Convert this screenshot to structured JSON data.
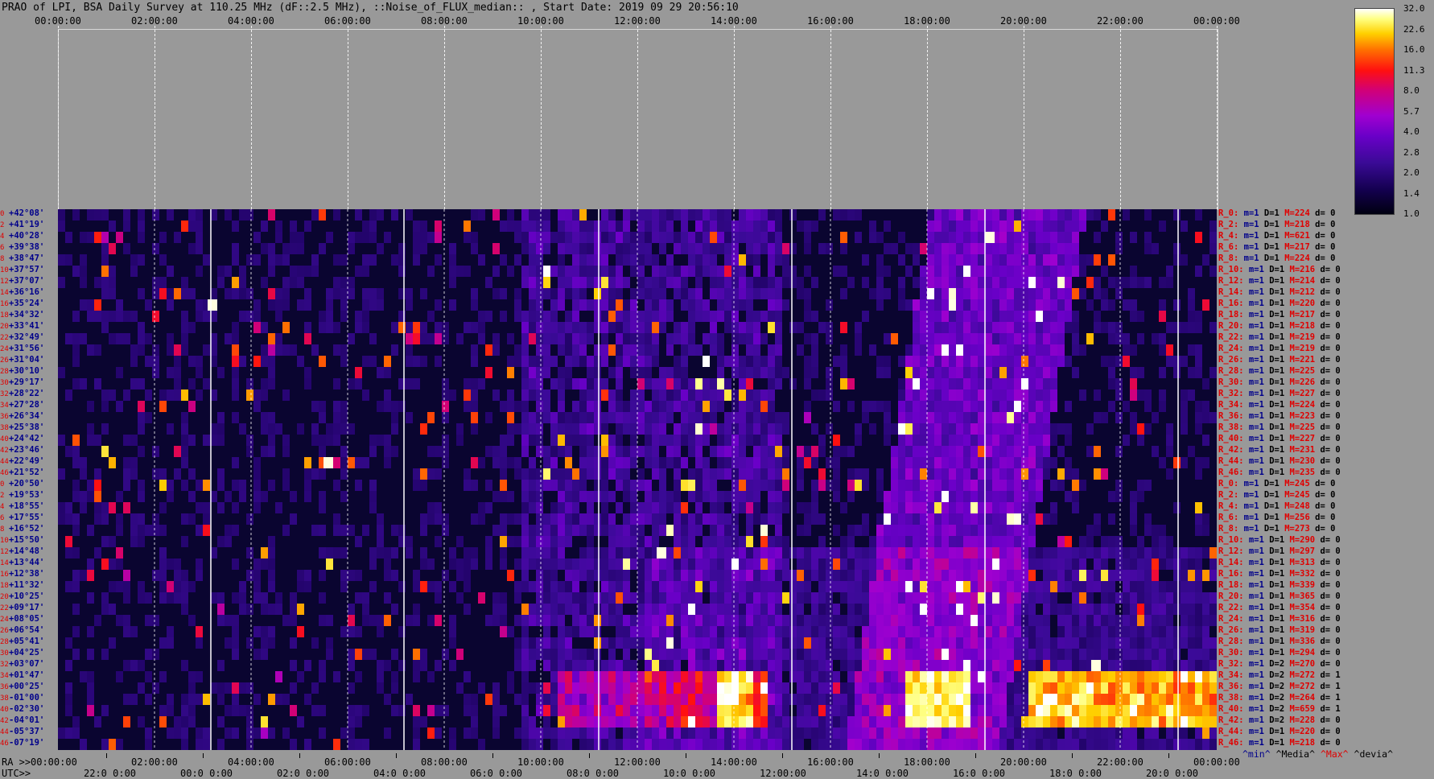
{
  "title": "PRAO of LPI, BSA Daily Survey at 110.25 MHz (dF::2.5 MHz), ::Noise_of_FLUX_median:: , Start Date: 2019 09 29 20:56:10",
  "top_axis": [
    "00:00:00",
    "02:00:00",
    "04:00:00",
    "06:00:00",
    "08:00:00",
    "10:00:00",
    "12:00:00",
    "14:00:00",
    "16:00:00",
    "18:00:00",
    "20:00:00",
    "22:00:00",
    "00:00:00"
  ],
  "bottom_axis": {
    "ra_label": "RA >>",
    "utc_label": "UTC>>",
    "ra_ticks": [
      "00:00:00",
      "02:00:00",
      "04:00:00",
      "06:00:00",
      "08:00:00",
      "10:00:00",
      "12:00:00",
      "14:00:00",
      "16:00:00",
      "18:00:00",
      "20:00:00",
      "22:00:00",
      "00:00:00"
    ],
    "utc_ticks": [
      "22:0 0:00",
      "00:0 0:00",
      "02:0 0:00",
      "04:0 0:00",
      "06:0 0:00",
      "08:0 0:00",
      "10:0 0:00",
      "12:00:00",
      "14:0 0:00",
      "16:0 0:00",
      "18:0 0:00",
      "20:0 0:00"
    ]
  },
  "colorbar": {
    "labels": [
      "32.0",
      "22.6",
      "16.0",
      "11.3",
      "8.0",
      "5.7",
      "4.0",
      "2.8",
      "2.0",
      "1.4",
      "1.0"
    ]
  },
  "legend_keys": {
    "min": "^min^",
    "median": "^Media^",
    "max": "^Max^",
    "dev": "^devia^"
  },
  "colors": {
    "background": "#999999",
    "dec_label": "#00008b",
    "row_index": "#e00000",
    "max_label": "#e00000"
  },
  "chart_data": {
    "type": "heatmap",
    "x_axis": "RA (hours)",
    "xlim": [
      0,
      24
    ],
    "y_axis": "Declination",
    "rows": [
      {
        "idx": "0",
        "dec": "+42°08'"
      },
      {
        "idx": "2",
        "dec": "+41°19'"
      },
      {
        "idx": "4",
        "dec": "+40°28'"
      },
      {
        "idx": "6",
        "dec": "+39°38'"
      },
      {
        "idx": "8",
        "dec": "+38°47'"
      },
      {
        "idx": "10",
        "dec": "+37°57'"
      },
      {
        "idx": "12",
        "dec": "+37°07'"
      },
      {
        "idx": "14",
        "dec": "+36°16'"
      },
      {
        "idx": "16",
        "dec": "+35°24'"
      },
      {
        "idx": "18",
        "dec": "+34°32'"
      },
      {
        "idx": "20",
        "dec": "+33°41'"
      },
      {
        "idx": "22",
        "dec": "+32°49'"
      },
      {
        "idx": "24",
        "dec": "+31°56'"
      },
      {
        "idx": "26",
        "dec": "+31°04'"
      },
      {
        "idx": "28",
        "dec": "+30°10'"
      },
      {
        "idx": "30",
        "dec": "+29°17'"
      },
      {
        "idx": "32",
        "dec": "+28°22'"
      },
      {
        "idx": "34",
        "dec": "+27°28'"
      },
      {
        "idx": "36",
        "dec": "+26°34'"
      },
      {
        "idx": "38",
        "dec": "+25°38'"
      },
      {
        "idx": "40",
        "dec": "+24°42'"
      },
      {
        "idx": "42",
        "dec": "+23°46'"
      },
      {
        "idx": "44",
        "dec": "+22°49'"
      },
      {
        "idx": "46",
        "dec": "+21°52'"
      },
      {
        "idx": "0",
        "dec": "+20°50'"
      },
      {
        "idx": "2",
        "dec": "+19°53'"
      },
      {
        "idx": "4",
        "dec": "+18°55'"
      },
      {
        "idx": "6",
        "dec": "+17°55'"
      },
      {
        "idx": "8",
        "dec": "+16°52'"
      },
      {
        "idx": "10",
        "dec": "+15°50'"
      },
      {
        "idx": "12",
        "dec": "+14°48'"
      },
      {
        "idx": "14",
        "dec": "+13°44'"
      },
      {
        "idx": "16",
        "dec": "+12°38'"
      },
      {
        "idx": "18",
        "dec": "+11°32'"
      },
      {
        "idx": "20",
        "dec": "+10°25'"
      },
      {
        "idx": "22",
        "dec": "+09°17'"
      },
      {
        "idx": "24",
        "dec": "+08°05'"
      },
      {
        "idx": "26",
        "dec": "+06°54'"
      },
      {
        "idx": "28",
        "dec": "+05°41'"
      },
      {
        "idx": "30",
        "dec": "+04°25'"
      },
      {
        "idx": "32",
        "dec": "+03°07'"
      },
      {
        "idx": "34",
        "dec": "+01°47'"
      },
      {
        "idx": "36",
        "dec": "+00°25'"
      },
      {
        "idx": "38",
        "dec": "-01°00'"
      },
      {
        "idx": "40",
        "dec": "-02°30'"
      },
      {
        "idx": "42",
        "dec": "-04°01'"
      },
      {
        "idx": "44",
        "dec": "-05°37'"
      },
      {
        "idx": "46",
        "dec": "-07°19'"
      }
    ],
    "row_stats": [
      {
        "r": "R_0:",
        "m": "m=1",
        "d": "D=1",
        "M": "M=224",
        "dev": "d= 0"
      },
      {
        "r": "R_2:",
        "m": "m=1",
        "d": "D=1",
        "M": "M=218",
        "dev": "d= 0"
      },
      {
        "r": "R_4:",
        "m": "m=1",
        "d": "D=1",
        "M": "M=621",
        "dev": "d= 0"
      },
      {
        "r": "R_6:",
        "m": "m=1",
        "d": "D=1",
        "M": "M=217",
        "dev": "d= 0"
      },
      {
        "r": "R_8:",
        "m": "m=1",
        "d": "D=1",
        "M": "M=224",
        "dev": "d= 0"
      },
      {
        "r": "R_10:",
        "m": "m=1",
        "d": "D=1",
        "M": "M=216",
        "dev": "d= 0"
      },
      {
        "r": "R_12:",
        "m": "m=1",
        "d": "D=1",
        "M": "M=214",
        "dev": "d= 0"
      },
      {
        "r": "R_14:",
        "m": "m=1",
        "d": "D=1",
        "M": "M=212",
        "dev": "d= 0"
      },
      {
        "r": "R_16:",
        "m": "m=1",
        "d": "D=1",
        "M": "M=220",
        "dev": "d= 0"
      },
      {
        "r": "R_18:",
        "m": "m=1",
        "d": "D=1",
        "M": "M=217",
        "dev": "d= 0"
      },
      {
        "r": "R_20:",
        "m": "m=1",
        "d": "D=1",
        "M": "M=218",
        "dev": "d= 0"
      },
      {
        "r": "R_22:",
        "m": "m=1",
        "d": "D=1",
        "M": "M=219",
        "dev": "d= 0"
      },
      {
        "r": "R_24:",
        "m": "m=1",
        "d": "D=1",
        "M": "M=219",
        "dev": "d= 0"
      },
      {
        "r": "R_26:",
        "m": "m=1",
        "d": "D=1",
        "M": "M=221",
        "dev": "d= 0"
      },
      {
        "r": "R_28:",
        "m": "m=1",
        "d": "D=1",
        "M": "M=225",
        "dev": "d= 0"
      },
      {
        "r": "R_30:",
        "m": "m=1",
        "d": "D=1",
        "M": "M=226",
        "dev": "d= 0"
      },
      {
        "r": "R_32:",
        "m": "m=1",
        "d": "D=1",
        "M": "M=227",
        "dev": "d= 0"
      },
      {
        "r": "R_34:",
        "m": "m=1",
        "d": "D=1",
        "M": "M=224",
        "dev": "d= 0"
      },
      {
        "r": "R_36:",
        "m": "m=1",
        "d": "D=1",
        "M": "M=223",
        "dev": "d= 0"
      },
      {
        "r": "R_38:",
        "m": "m=1",
        "d": "D=1",
        "M": "M=225",
        "dev": "d= 0"
      },
      {
        "r": "R_40:",
        "m": "m=1",
        "d": "D=1",
        "M": "M=227",
        "dev": "d= 0"
      },
      {
        "r": "R_42:",
        "m": "m=1",
        "d": "D=1",
        "M": "M=231",
        "dev": "d= 0"
      },
      {
        "r": "R_44:",
        "m": "m=1",
        "d": "D=1",
        "M": "M=230",
        "dev": "d= 0"
      },
      {
        "r": "R_46:",
        "m": "m=1",
        "d": "D=1",
        "M": "M=235",
        "dev": "d= 0"
      },
      {
        "r": "R_0:",
        "m": "m=1",
        "d": "D=1",
        "M": "M=245",
        "dev": "d= 0"
      },
      {
        "r": "R_2:",
        "m": "m=1",
        "d": "D=1",
        "M": "M=245",
        "dev": "d= 0"
      },
      {
        "r": "R_4:",
        "m": "m=1",
        "d": "D=1",
        "M": "M=248",
        "dev": "d= 0"
      },
      {
        "r": "R_6:",
        "m": "m=1",
        "d": "D=1",
        "M": "M=256",
        "dev": "d= 0"
      },
      {
        "r": "R_8:",
        "m": "m=1",
        "d": "D=1",
        "M": "M=273",
        "dev": "d= 0"
      },
      {
        "r": "R_10:",
        "m": "m=1",
        "d": "D=1",
        "M": "M=290",
        "dev": "d= 0"
      },
      {
        "r": "R_12:",
        "m": "m=1",
        "d": "D=1",
        "M": "M=297",
        "dev": "d= 0"
      },
      {
        "r": "R_14:",
        "m": "m=1",
        "d": "D=1",
        "M": "M=313",
        "dev": "d= 0"
      },
      {
        "r": "R_16:",
        "m": "m=1",
        "d": "D=1",
        "M": "M=332",
        "dev": "d= 0"
      },
      {
        "r": "R_18:",
        "m": "m=1",
        "d": "D=1",
        "M": "M=339",
        "dev": "d= 0"
      },
      {
        "r": "R_20:",
        "m": "m=1",
        "d": "D=1",
        "M": "M=365",
        "dev": "d= 0"
      },
      {
        "r": "R_22:",
        "m": "m=1",
        "d": "D=1",
        "M": "M=354",
        "dev": "d= 0"
      },
      {
        "r": "R_24:",
        "m": "m=1",
        "d": "D=1",
        "M": "M=316",
        "dev": "d= 0"
      },
      {
        "r": "R_26:",
        "m": "m=1",
        "d": "D=1",
        "M": "M=319",
        "dev": "d= 0"
      },
      {
        "r": "R_28:",
        "m": "m=1",
        "d": "D=1",
        "M": "M=336",
        "dev": "d= 0"
      },
      {
        "r": "R_30:",
        "m": "m=1",
        "d": "D=1",
        "M": "M=294",
        "dev": "d= 0"
      },
      {
        "r": "R_32:",
        "m": "m=1",
        "d": "D=2",
        "M": "M=270",
        "dev": "d= 0"
      },
      {
        "r": "R_34:",
        "m": "m=1",
        "d": "D=2",
        "M": "M=272",
        "dev": "d= 1"
      },
      {
        "r": "R_36:",
        "m": "m=1",
        "d": "D=2",
        "M": "M=272",
        "dev": "d= 1"
      },
      {
        "r": "R_38:",
        "m": "m=1",
        "d": "D=2",
        "M": "M=264",
        "dev": "d= 1"
      },
      {
        "r": "R_40:",
        "m": "m=1",
        "d": "D=2",
        "M": "M=659",
        "dev": "d= 1"
      },
      {
        "r": "R_42:",
        "m": "m=1",
        "d": "D=2",
        "M": "M=228",
        "dev": "d= 0"
      },
      {
        "r": "R_44:",
        "m": "m=1",
        "d": "D=1",
        "M": "M=220",
        "dev": "d= 0"
      },
      {
        "r": "R_46:",
        "m": "m=1",
        "d": "D=1",
        "M": "M=218",
        "dev": "d= 0"
      }
    ],
    "colorscale_range": [
      1.0,
      32.0
    ],
    "bright_sources_ra_hours": [
      3.2,
      5.6,
      12.5,
      19.3,
      21.5
    ],
    "continuous_band_rows": [
      41,
      42,
      43,
      44,
      45
    ]
  }
}
